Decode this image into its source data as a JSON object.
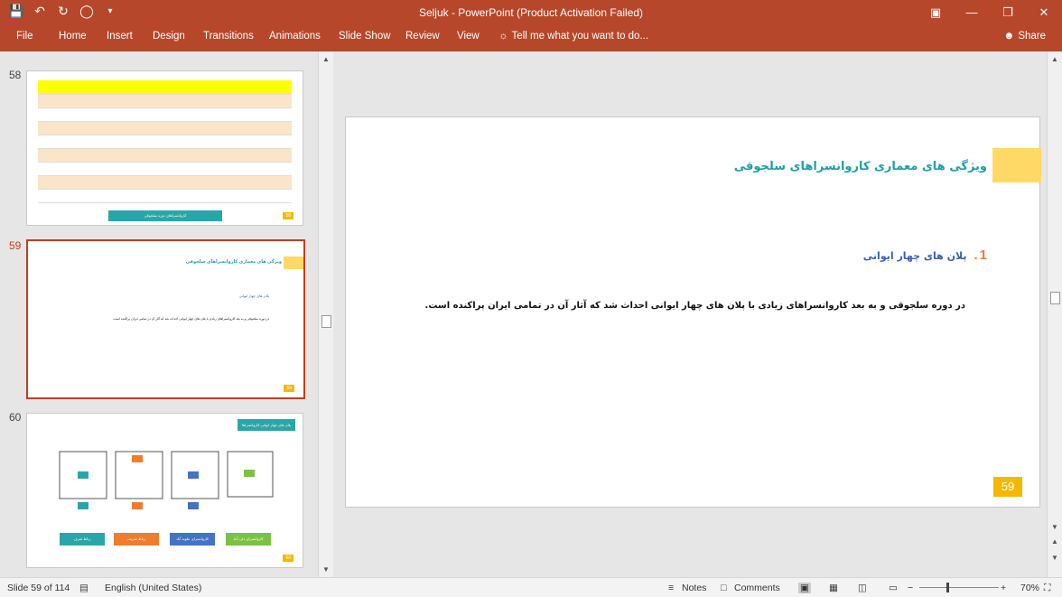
{
  "window": {
    "title": "Seljuk - PowerPoint (Product Activation Failed)"
  },
  "ribbon": {
    "tabs": [
      "File",
      "Home",
      "Insert",
      "Design",
      "Transitions",
      "Animations",
      "Slide Show",
      "Review",
      "View"
    ],
    "tell_me": "Tell me what you want to do...",
    "share": "Share"
  },
  "thumbnails": [
    {
      "number": "58",
      "badge": "58",
      "caption_button": "کاروانسراهای دوره سلجوقی"
    },
    {
      "number": "59",
      "badge": "59",
      "title": "ویژگی های معماری کاروانسراهای سلجوقی",
      "item": "پلان های چهار ایوانی",
      "body": "در دوره سلجوقی و به بعد کاروانسراهای زیادی با پلان های چهار ایوانی احداث شد که آثار آن در تمامی ایران پراکنده است."
    },
    {
      "number": "60",
      "badge": "60",
      "header": "پلان های چهار ایوانی کاروانسراها",
      "labels": [
        "رباط شرف",
        "رباط شریف",
        "کاروانسرای علویه آباد",
        "کاروانسرای دلی آباد"
      ]
    }
  ],
  "slide": {
    "title": "ویژگی های معماری کاروانسراهای سلجوقی",
    "item_number": "1",
    "item_dot": ".",
    "item_text": "پلان های چهار ایوانی",
    "body": "در دوره سلجوقی و به بعد کاروانسراهای زیادی با پلان های چهار ایوانی احداث شد که آثار آن در تمامی ایران پراکنده است.",
    "page_badge": "59"
  },
  "status": {
    "slide_info": "Slide 59 of 114",
    "language": "English (United States)",
    "notes": "Notes",
    "comments": "Comments",
    "zoom": "70%",
    "zoom_minus": "−",
    "zoom_plus": "+"
  },
  "colors": {
    "ribbon": "#b7472a",
    "accent_yellow": "#ffd966",
    "title_teal": "#1f9ea8",
    "item_blue": "#3a5fb0",
    "badge_orange": "#f5b800"
  }
}
